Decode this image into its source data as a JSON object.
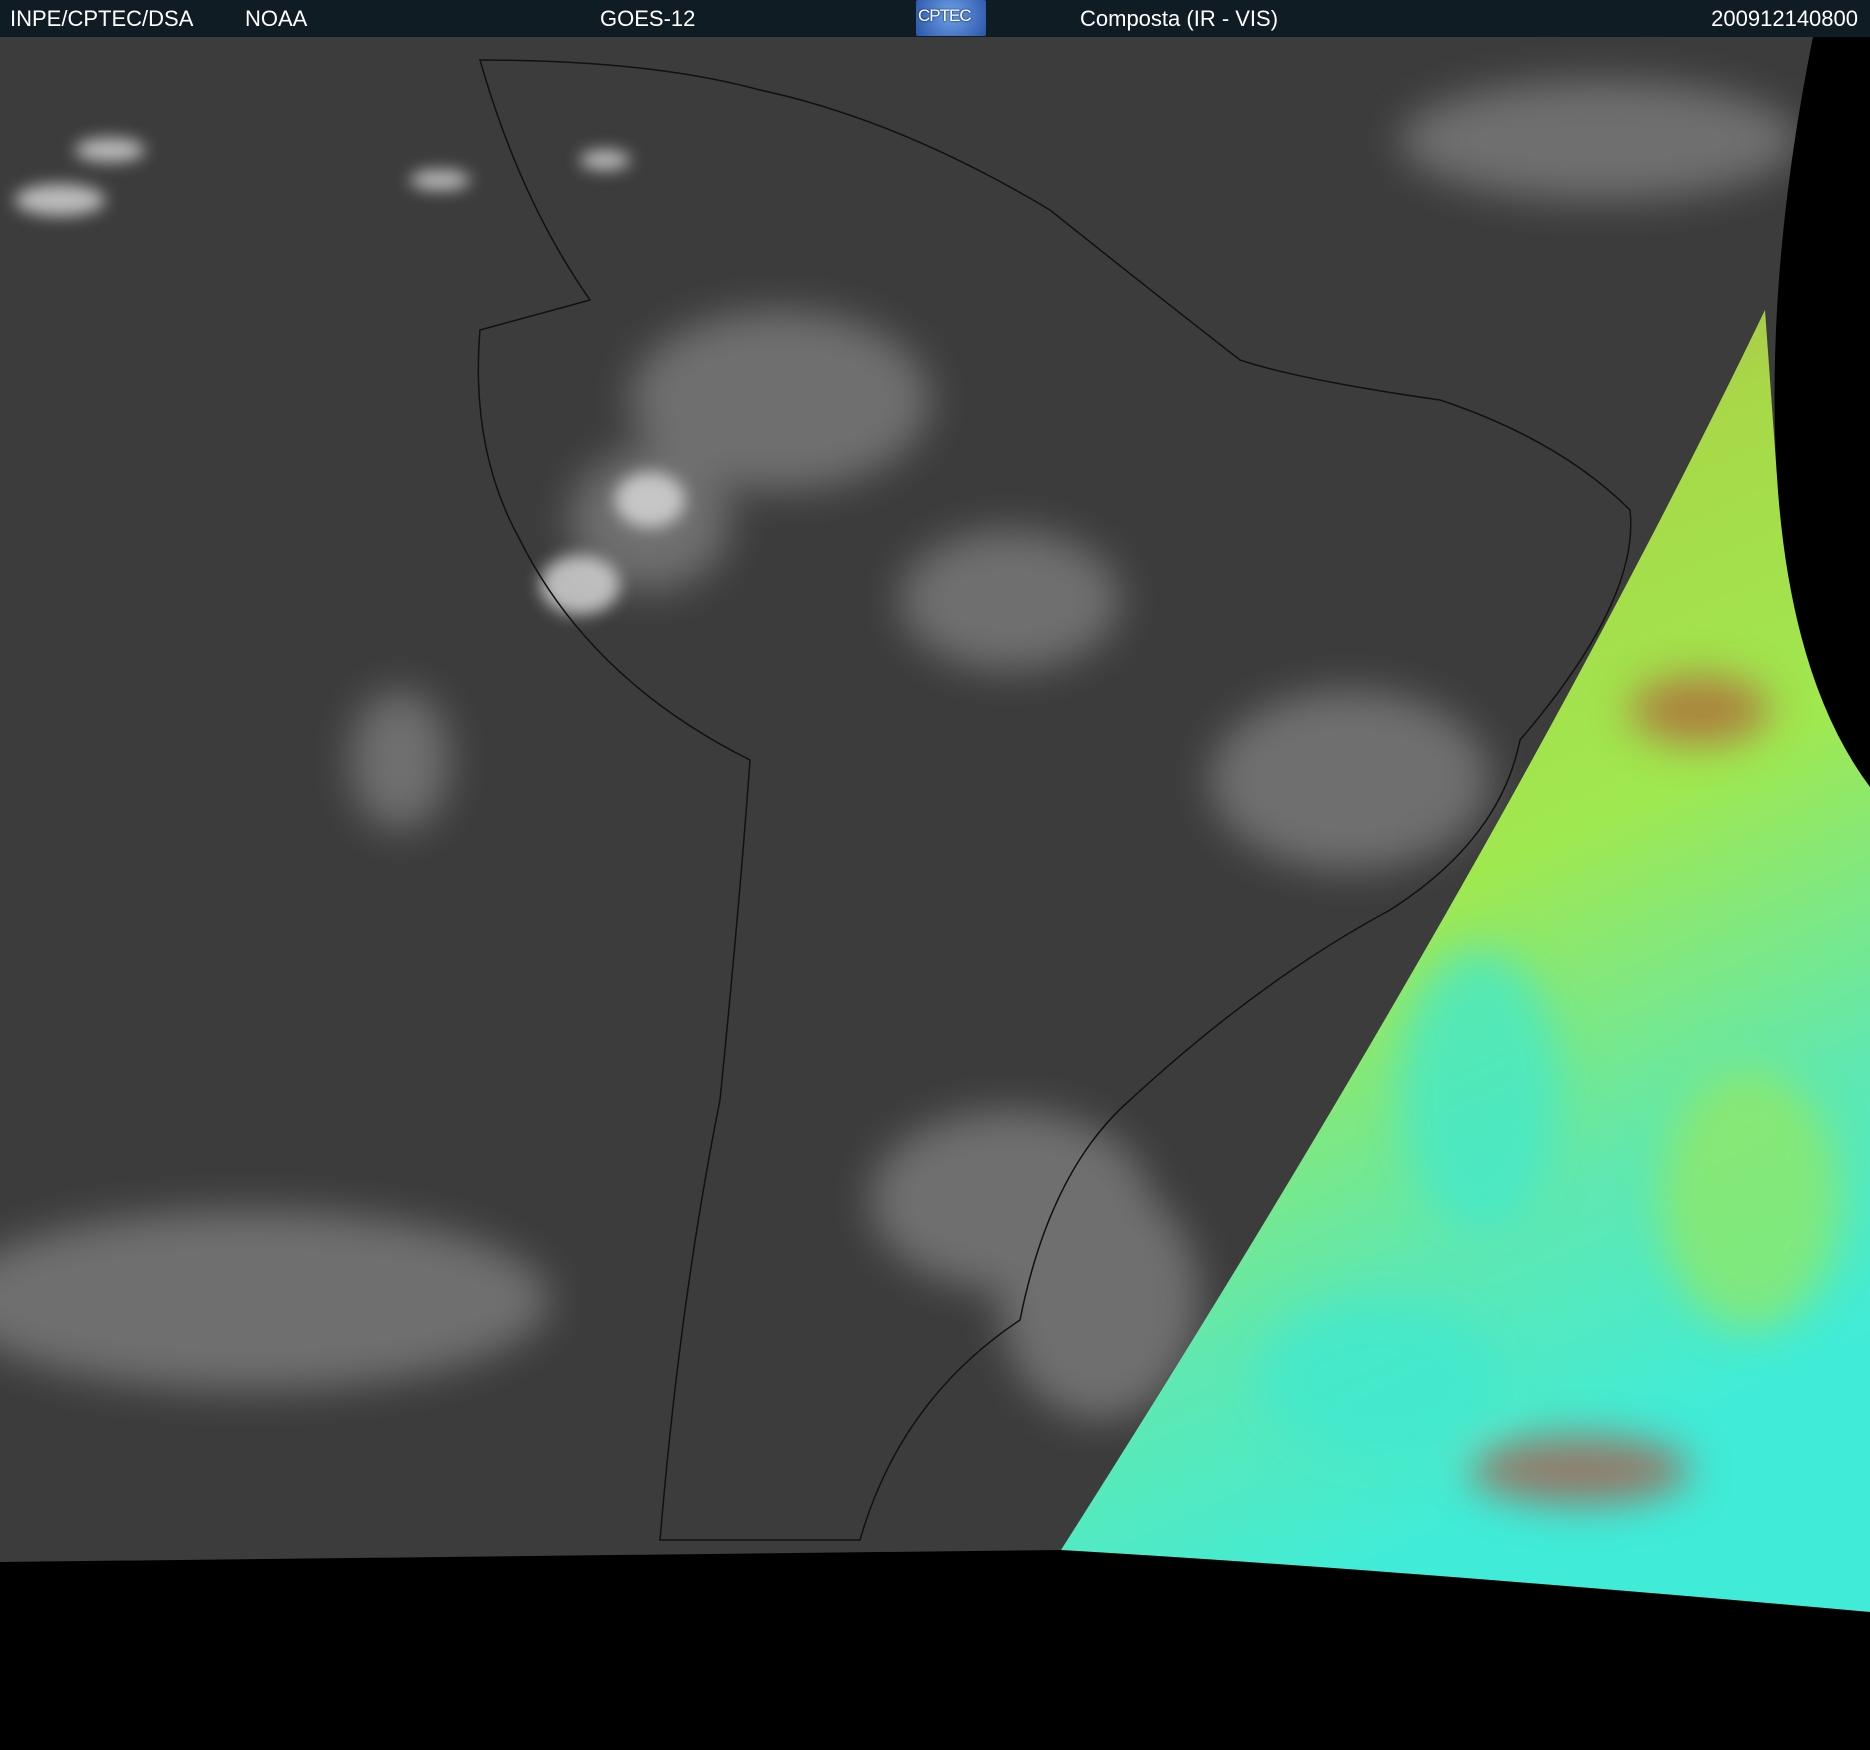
{
  "header": {
    "agency": "INPE/CPTEC/DSA",
    "source": "NOAA",
    "satellite": "GOES-12",
    "logo_text": "CPTEC",
    "product": "Composta (IR - VIS)",
    "timestamp": "200912140800"
  },
  "colors": {
    "header_bg": "#101c24",
    "ir_gray": "#3a3a3a",
    "vis_green": "#a8e048",
    "vis_cyan": "#40e8d0",
    "vis_brown": "#a06040"
  }
}
